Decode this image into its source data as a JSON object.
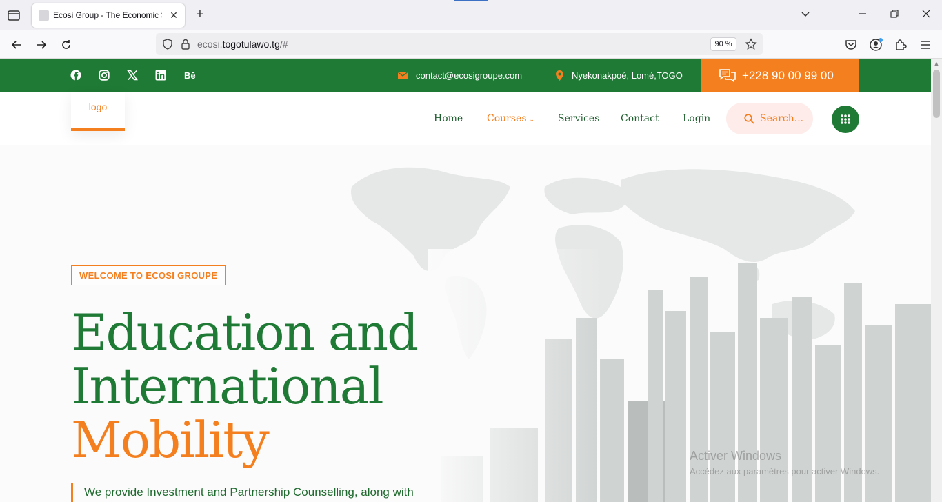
{
  "browser": {
    "tab": {
      "title": "Ecosi Group - The Economic Su"
    },
    "url": {
      "prefix": "ecosi.",
      "host": "togotulawo.tg",
      "suffix": "/#"
    },
    "zoom": "90 %"
  },
  "topbar": {
    "socials": [
      "facebook",
      "instagram",
      "x",
      "linkedin",
      "behance"
    ],
    "behance_label": "Bē",
    "email": "contact@ecosigroupe.com",
    "address": "Nyekonakpoé, Lomé,TOGO",
    "phone": "+228 90 00 99 00"
  },
  "header": {
    "logo": "logo",
    "menu": {
      "home": "Home",
      "courses": "Courses",
      "services": "Services",
      "contact": "Contact",
      "login": "Login"
    },
    "search_placeholder": "Search..."
  },
  "hero": {
    "tag": "WELCOME TO ECOSI GROUPE",
    "title_line1": "Education and",
    "title_line2": "International",
    "title_line3": "Mobility",
    "subtitle": "We provide Investment and Partnership Counselling, along with"
  },
  "watermark": {
    "line1": "Activer Windows",
    "line2": "Accédez aux paramètres pour activer Windows."
  },
  "colors": {
    "green": "#1f7a35",
    "orange": "#f47f1f"
  }
}
